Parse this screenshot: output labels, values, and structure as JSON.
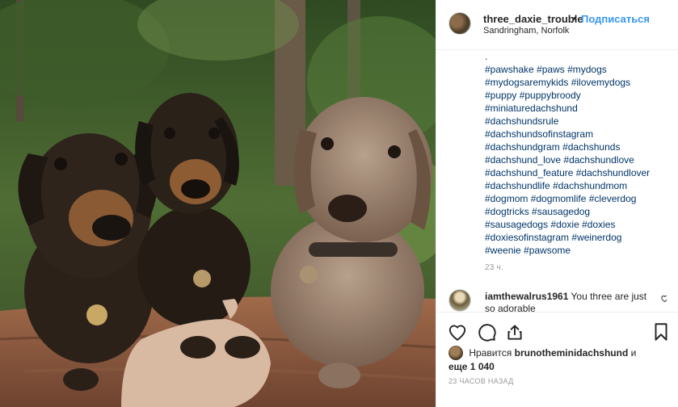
{
  "post": {
    "photo_alt": "three dachshunds on a log in a forest"
  },
  "header": {
    "username": "three_daxie_trouble",
    "separator": "•",
    "follow_label": "Подписаться",
    "location": "Sandringham, Norfolk"
  },
  "caption": {
    "lines": [
      ".",
      "#pawshake #paws #mydogs",
      "#mydogsaremykids #ilovemydogs",
      "#puppy #puppybroody",
      "#miniaturedachshund",
      "#dachshundsrule",
      "#dachshundsofinstagram",
      "#dachshundgram #dachshunds",
      "#dachshund_love #dachshundlove",
      "#dachshund_feature #dachshundlover",
      "#dachshundlife #dachshundmom",
      "#dogmom #dogmomlife #cleverdog",
      "#dogtricks #sausagedog",
      "#sausagedogs #doxie #doxies",
      "#doxiesofinstagram #weinerdog",
      "#weenie #pawsome"
    ],
    "time": "23 ч."
  },
  "comment": {
    "username": "iamthewalrus1961",
    "text": "You three are just so adorable"
  },
  "actions": {
    "like_icon": "heart-icon",
    "comment_icon": "comment-icon",
    "share_icon": "share-icon",
    "save_icon": "bookmark-icon"
  },
  "likes": {
    "prefix": "Нравится",
    "user": "brunotheminidachshund",
    "suffix": "и",
    "others": "еще 1 040"
  },
  "posted_ago": "23 ЧАСОВ НАЗАД",
  "colors": {
    "link_blue": "#3897f0",
    "hashtag": "#003569",
    "muted": "#999999",
    "border": "#efefef"
  }
}
